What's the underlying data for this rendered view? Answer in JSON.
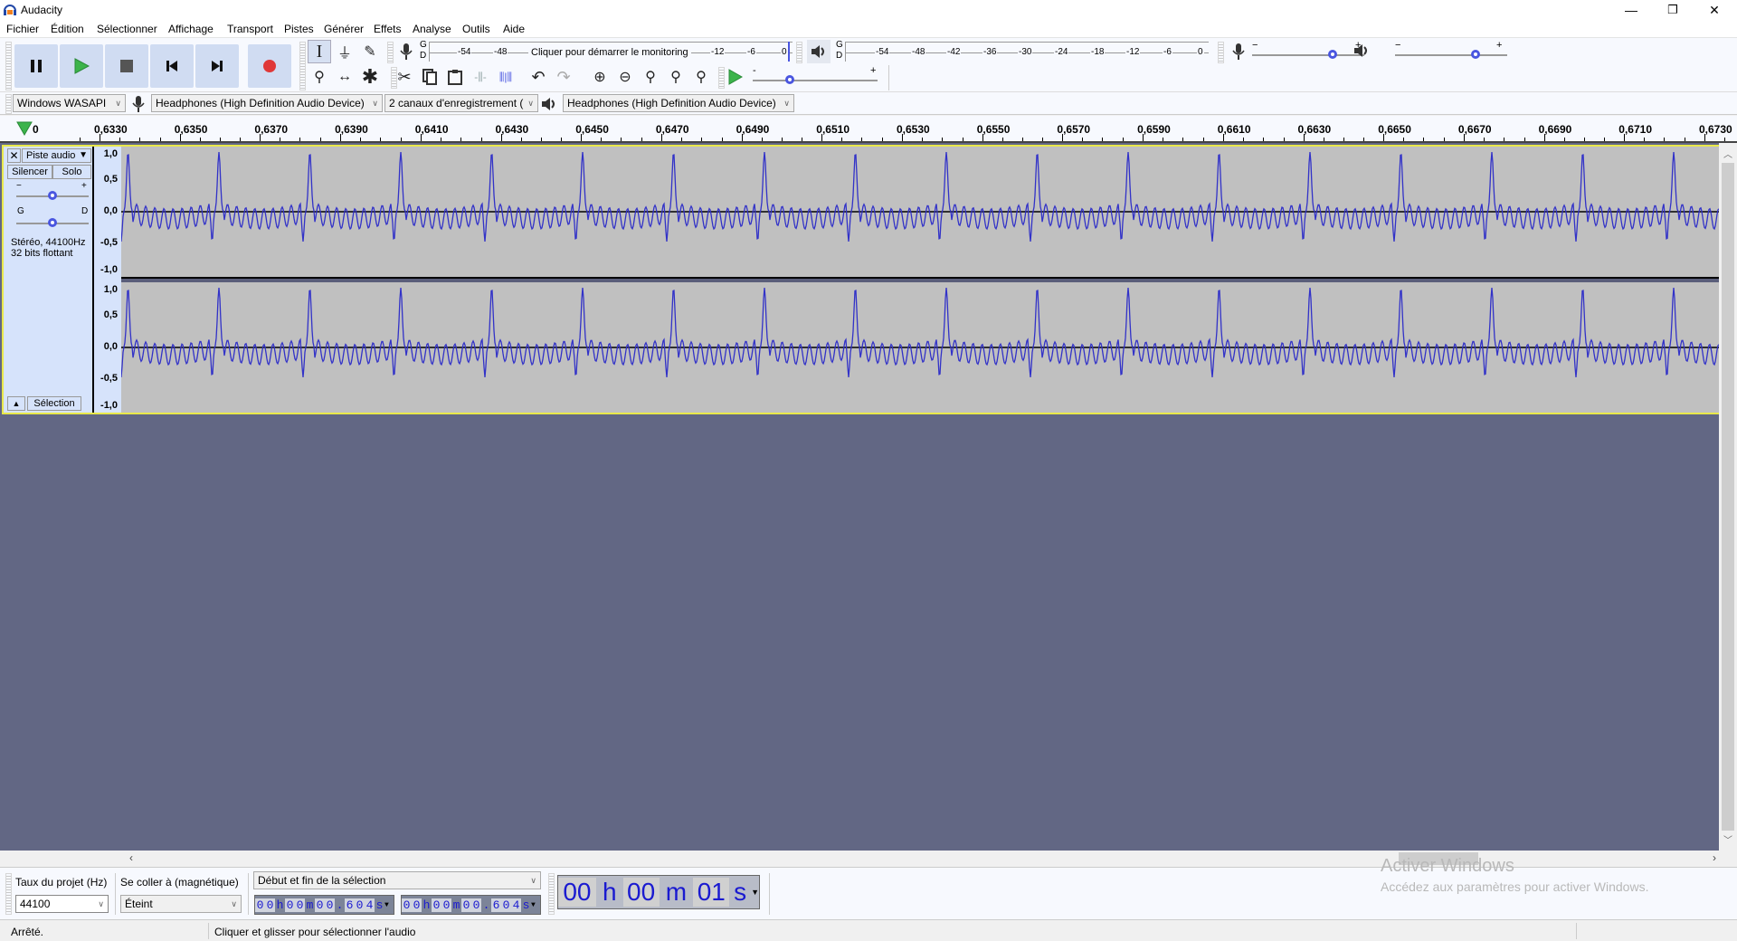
{
  "window": {
    "title": "Audacity",
    "controls": {
      "minimize": "—",
      "restore": "❐",
      "close": "✕"
    }
  },
  "menubar": [
    {
      "label": "Fichier",
      "accel": "F"
    },
    {
      "label": "Édition",
      "accel": "d"
    },
    {
      "label": "Sélectionner",
      "accel": "S"
    },
    {
      "label": "Affichage",
      "accel": "A"
    },
    {
      "label": "Transport",
      "accel": "n"
    },
    {
      "label": "Pistes",
      "accel": "P"
    },
    {
      "label": "Générer",
      "accel": "G"
    },
    {
      "label": "Effets",
      "accel": "E"
    },
    {
      "label": "Analyse",
      "accel": "y"
    },
    {
      "label": "Outils",
      "accel": "O"
    },
    {
      "label": "Aide",
      "accel": "i"
    }
  ],
  "transport": {
    "buttons": [
      "pause",
      "play",
      "stop",
      "skip-to-start",
      "skip-to-end",
      "record"
    ],
    "colors": {
      "play": "#3cb44b",
      "record": "#e03838",
      "button_bg": "#d0dcf2"
    }
  },
  "tools": {
    "row1": [
      "selection-tool",
      "envelope-tool",
      "draw-tool"
    ],
    "row2": [
      "zoom-tool",
      "time-shift-tool",
      "multi-tool"
    ],
    "active": "selection-tool"
  },
  "recording_meter": {
    "channels": [
      "G",
      "D"
    ],
    "ticks": [
      "-54",
      "-48",
      "-12",
      "-6",
      "0"
    ],
    "prompt": "Cliquer pour démarrer le monitoring"
  },
  "playback_meter": {
    "channels": [
      "G",
      "D"
    ],
    "ticks": [
      "-54",
      "-48",
      "-42",
      "-36",
      "-30",
      "-24",
      "-18",
      "-12",
      "-6",
      "0"
    ]
  },
  "mixer": {
    "recording_volume": 0.72,
    "playback_volume": 0.72,
    "minus": "−",
    "plus": "+"
  },
  "edit_toolbar": [
    "cut",
    "copy",
    "paste",
    "trim",
    "silence",
    "undo",
    "redo",
    "zoom-in",
    "zoom-out",
    "fit-selection",
    "fit-project",
    "zoom-toggle"
  ],
  "play_at_speed": {
    "speed": 0.3,
    "minus": "-",
    "plus": "+"
  },
  "device_toolbar": {
    "host": "Windows WASAPI",
    "recording_device": "Headphones (High Definition Audio Device)",
    "channels": "2 canaux d'enregistrement (",
    "playback_device": "Headphones (High Definition Audio Device)"
  },
  "ruler": {
    "start_label": "0",
    "labels": [
      "0,6330",
      "0,6350",
      "0,6370",
      "0,6390",
      "0,6410",
      "0,6430",
      "0,6450",
      "0,6470",
      "0,6490",
      "0,6510",
      "0,6530",
      "0,6550",
      "0,6570",
      "0,6590",
      "0,6610",
      "0,6630",
      "0,6650",
      "0,6670",
      "0,6690",
      "0,6710",
      "0,6730"
    ]
  },
  "track": {
    "name": "Piste audio",
    "mute": "Silencer",
    "solo": "Solo",
    "gain": {
      "minus": "−",
      "plus": "+",
      "value": 0.5
    },
    "pan": {
      "left": "G",
      "right": "D",
      "value": 0.5
    },
    "info_line1": "Stéréo, 44100Hz",
    "info_line2": "32 bits flottant",
    "select_button": "Sélection",
    "scale_labels": [
      "1,0",
      "0,5",
      "0,0",
      "-0,5",
      "-1,0"
    ],
    "wave_color": "#3232c8",
    "wave_bg": "#c0c0c0"
  },
  "selection_toolbar": {
    "rate_label": "Taux du projet (Hz)",
    "rate_value": "44100",
    "snap_label": "Se coller à (magnétique)",
    "snap_value": "Éteint",
    "mode": "Début et fin de la sélection",
    "start_time": [
      "0",
      "0",
      "h",
      "0",
      "0",
      "m",
      "0",
      "0",
      ".",
      "6",
      "0",
      "4",
      "s"
    ],
    "end_time": [
      "0",
      "0",
      "h",
      "0",
      "0",
      "m",
      "0",
      "0",
      ".",
      "6",
      "0",
      "4",
      "s"
    ]
  },
  "time_display": {
    "hh": "00",
    "h": "h",
    "mm": "00",
    "m": "m",
    "ss": "01",
    "s": "s"
  },
  "statusbar": {
    "state": "Arrêté.",
    "hint": "Cliquer et glisser pour sélectionner l'audio"
  },
  "watermark": {
    "title": "Activer Windows",
    "subtitle": "Accédez aux paramètres pour activer Windows."
  }
}
